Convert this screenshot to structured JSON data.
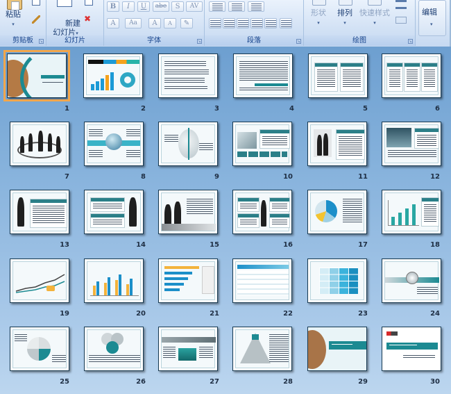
{
  "ribbon": {
    "clipboard": {
      "paste_label": "粘贴",
      "group_label": "剪贴板"
    },
    "slides": {
      "new_slide_label": "新建\n幻灯片",
      "new_slide_dropdown": "▾",
      "group_label": "幻灯片"
    },
    "font": {
      "group_label": "字体",
      "bold": "B",
      "italic": "I",
      "underline": "U",
      "strike": "abe",
      "shadow": "S",
      "spacing": "AV",
      "font_color": "A",
      "change_case": "Aa",
      "grow": "A",
      "shrink": "A",
      "clear": "✎"
    },
    "paragraph": {
      "group_label": "段落"
    },
    "drawing": {
      "group_label": "绘图",
      "shape_label": "形状",
      "arrange_label": "排列",
      "quick_styles_label": "快速样式"
    },
    "editing": {
      "edit_label": "编辑"
    }
  },
  "sorter": {
    "selected_slide": 1,
    "accent_color": "#1c8a92",
    "selection_color": "#f2a64b",
    "slides": [
      {
        "number": "1"
      },
      {
        "number": "2"
      },
      {
        "number": "3"
      },
      {
        "number": "4"
      },
      {
        "number": "5"
      },
      {
        "number": "6"
      },
      {
        "number": "7"
      },
      {
        "number": "8"
      },
      {
        "number": "9"
      },
      {
        "number": "10"
      },
      {
        "number": "11"
      },
      {
        "number": "12"
      },
      {
        "number": "13"
      },
      {
        "number": "14"
      },
      {
        "number": "15"
      },
      {
        "number": "16"
      },
      {
        "number": "17"
      },
      {
        "number": "18"
      },
      {
        "number": "19"
      },
      {
        "number": "20"
      },
      {
        "number": "21"
      },
      {
        "number": "22"
      },
      {
        "number": "23"
      },
      {
        "number": "24"
      },
      {
        "number": "25"
      },
      {
        "number": "26"
      },
      {
        "number": "27"
      },
      {
        "number": "28"
      },
      {
        "number": "29"
      },
      {
        "number": "30"
      }
    ]
  }
}
